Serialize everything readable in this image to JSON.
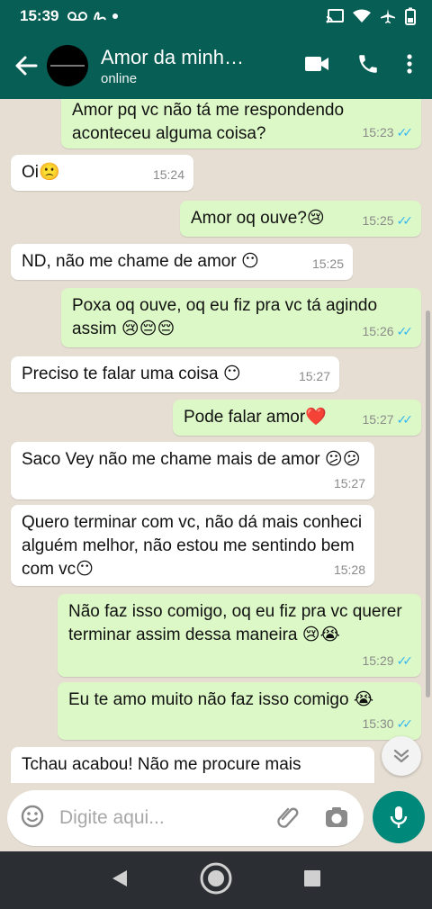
{
  "status_bar": {
    "time": "15:39"
  },
  "header": {
    "title": "Amor da minh…",
    "subtitle": "online"
  },
  "messages": [
    {
      "dir": "out",
      "text": "Amor pq vc não tá me respondendo aconteceu alguma coisa?",
      "time": "15:23",
      "read": true
    },
    {
      "dir": "in",
      "text": "Oi🙁",
      "time": "15:24"
    },
    {
      "dir": "out",
      "text": "Amor oq ouve?😢",
      "time": "15:25",
      "read": true
    },
    {
      "dir": "in",
      "text": "ND, não me chame de amor 😶",
      "time": "15:25"
    },
    {
      "dir": "out",
      "text": "Poxa oq ouve, oq eu fiz pra vc tá agindo assim 😢😔😔",
      "time": "15:26",
      "read": true
    },
    {
      "dir": "in",
      "text": "Preciso te falar uma coisa 😶",
      "time": "15:27"
    },
    {
      "dir": "out",
      "text": "Pode falar amor❤️",
      "time": "15:27",
      "read": true
    },
    {
      "dir": "in",
      "text": "Saco Vey não me chame mais de amor 😕😕",
      "time": "15:27"
    },
    {
      "dir": "in",
      "text": "Quero terminar com vc, não dá mais conheci alguém melhor, não estou me sentindo bem com vc😶",
      "time": "15:28"
    },
    {
      "dir": "out",
      "text": "Não faz isso comigo, oq eu fiz pra vc querer terminar assim dessa maneira 😢😭",
      "time": "15:29",
      "read": true
    },
    {
      "dir": "out",
      "text": "Eu te amo muito não faz isso comigo 😭",
      "time": "15:30",
      "read": true
    },
    {
      "dir": "in",
      "text": "Tchau acabou! Não me procure mais",
      "time": ""
    }
  ],
  "composer": {
    "placeholder": "Digite aqui..."
  },
  "icons": {
    "back": "arrow-left-icon",
    "video": "video-call-icon",
    "call": "phone-icon",
    "menu": "more-vert-icon",
    "emoji": "emoji-icon",
    "attach": "paperclip-icon",
    "camera": "camera-icon",
    "mic": "mic-icon",
    "scroll_down": "chevron-double-down-icon",
    "nav_back": "triangle-back-icon",
    "nav_home": "home-circle-icon",
    "nav_recent": "square-recent-icon"
  },
  "colors": {
    "header": "#075e54",
    "outgoing_bubble": "#dcf8c6",
    "incoming_bubble": "#ffffff",
    "chat_bg": "#e6ded3",
    "mic_button": "#00897b",
    "read_ticks": "#34b7f1"
  }
}
